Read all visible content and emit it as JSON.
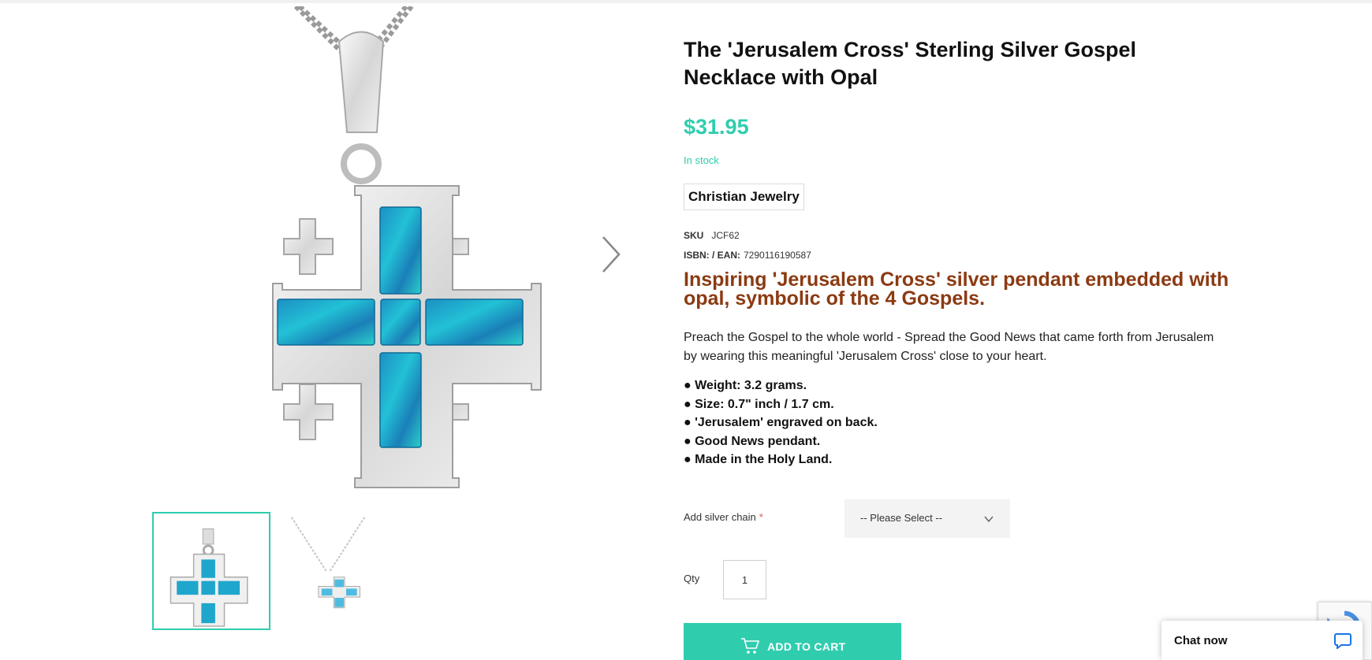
{
  "product": {
    "title": "The 'Jerusalem Cross' Sterling Silver Gospel Necklace with Opal",
    "price": "$31.95",
    "stock_status": "In stock",
    "category": "Christian Jewelry",
    "sku_label": "SKU",
    "sku_value": "JCF62",
    "isbn_label": "ISBN: / EAN:",
    "isbn_value": "7290116190587",
    "headline": "Inspiring 'Jerusalem Cross' silver pendant embedded with opal, symbolic of the 4 Gospels.",
    "description": "Preach the Gospel to the whole world - Spread the Good News that came forth from Jerusalem by wearing this meaningful 'Jerusalem Cross' close to your heart.",
    "features": [
      "● Weight: 3.2 grams.",
      "● Size: 0.7\" inch / 1.7 cm.",
      "● 'Jerusalem' engraved on back.",
      "● Good News pendant.",
      "● Made in the Holy Land."
    ]
  },
  "options": {
    "chain_label": "Add silver chain",
    "required_mark": "*",
    "chain_selected": "-- Please Select --",
    "qty_label": "Qty",
    "qty_value": "1"
  },
  "actions": {
    "add_to_cart": "ADD TO CART"
  },
  "chat": {
    "label": "Chat now"
  },
  "colors": {
    "accent": "#2fcdae",
    "headline": "#8b3a12",
    "opal": "#1ea3c9"
  },
  "icons": [
    "chevron-right-icon",
    "chevron-down-icon",
    "cart-icon",
    "chat-bubble-icon",
    "recaptcha-icon"
  ]
}
